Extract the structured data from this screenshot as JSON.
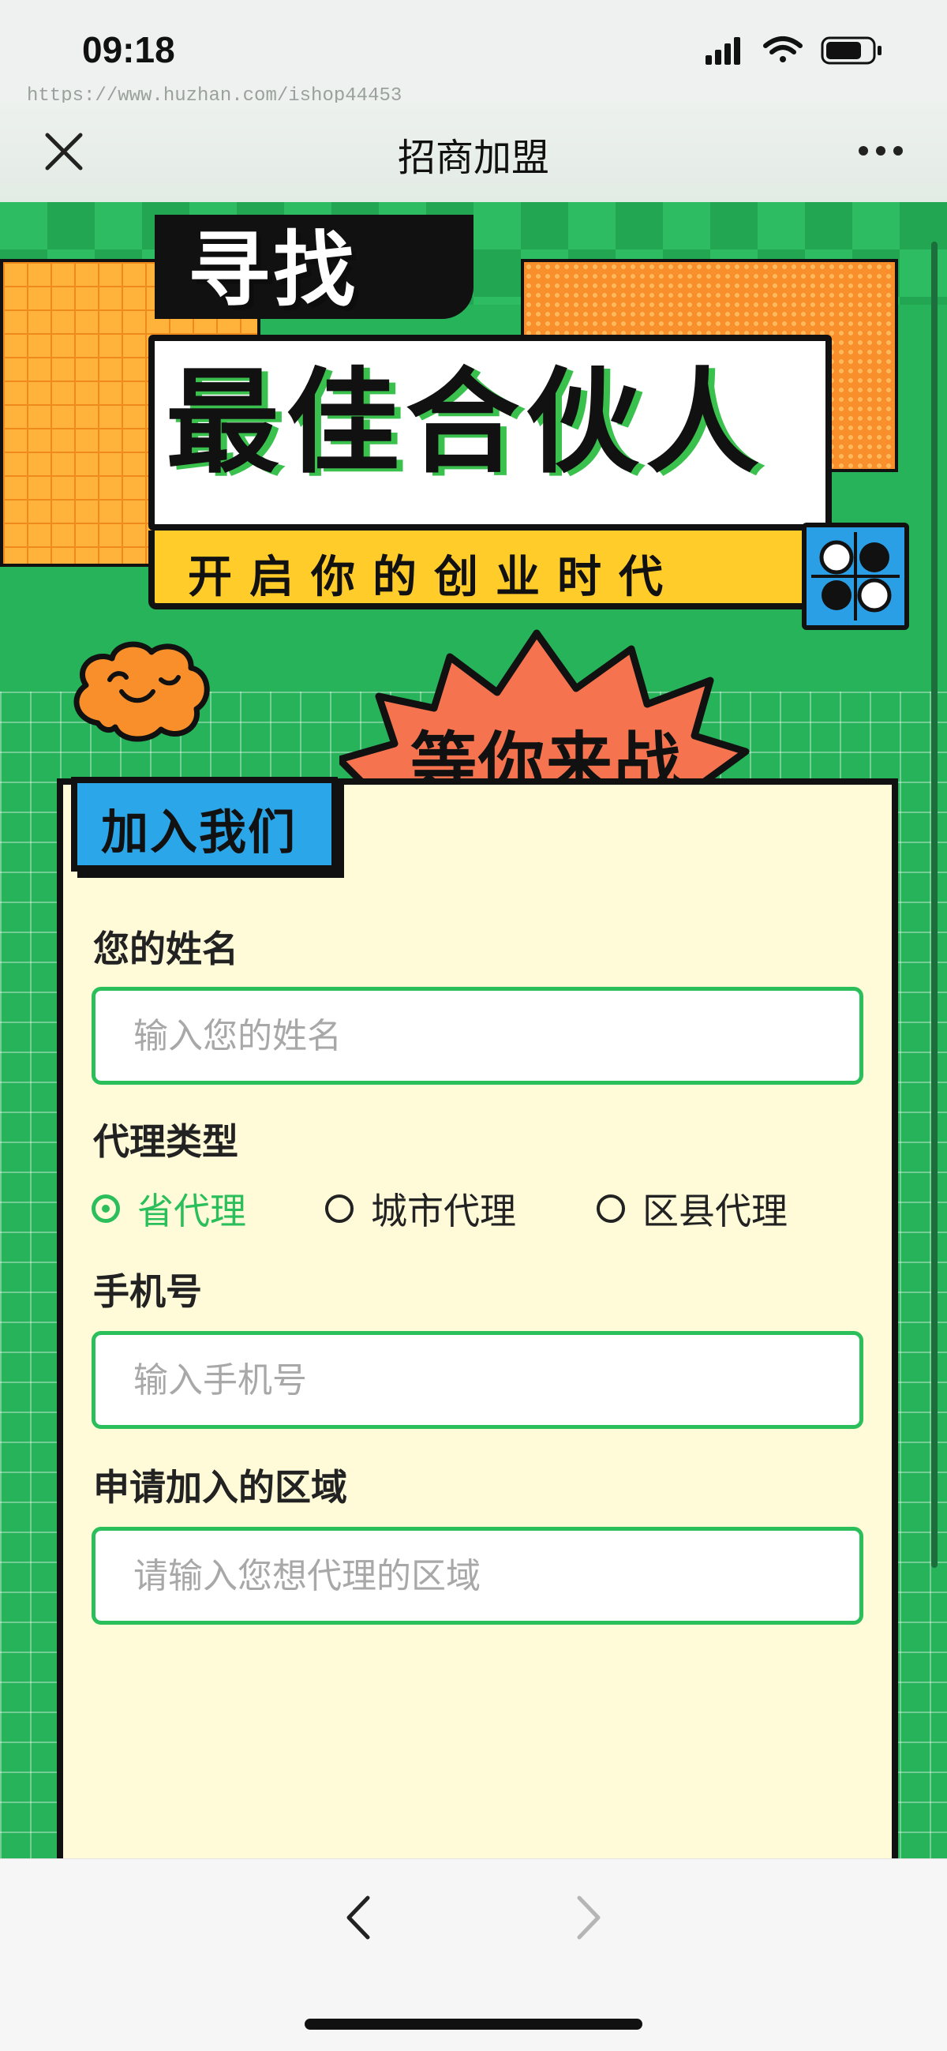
{
  "status_bar": {
    "time": "09:18",
    "watermark": "https://www.huzhan.com/ishop44453"
  },
  "nav": {
    "title": "招商加盟",
    "close_icon": "close-icon",
    "more_icon": "more-icon"
  },
  "banner": {
    "title_top": "寻找",
    "title_main": "最佳合伙人",
    "subtitle": "开启你的创业时代",
    "burst_text": "等你来战"
  },
  "form": {
    "tag": "加入我们",
    "name_label": "您的姓名",
    "name_placeholder": "输入您的姓名",
    "agent_type_label": "代理类型",
    "agent_options": [
      "省代理",
      "城市代理",
      "区县代理"
    ],
    "agent_selected": "省代理",
    "phone_label": "手机号",
    "phone_placeholder": "输入手机号",
    "region_label": "申请加入的区域",
    "region_placeholder": "请输入您想代理的区域"
  },
  "browser_bar": {
    "back_icon": "chevron-left-icon",
    "forward_icon": "chevron-right-icon"
  },
  "colors": {
    "accent_green": "#2bbf5c",
    "background_green": "#27b35a",
    "card_cream": "#fffbd9",
    "tag_blue": "#2ba6e8",
    "orange": "#f98f2a",
    "yellow": "#ffcc2a"
  }
}
